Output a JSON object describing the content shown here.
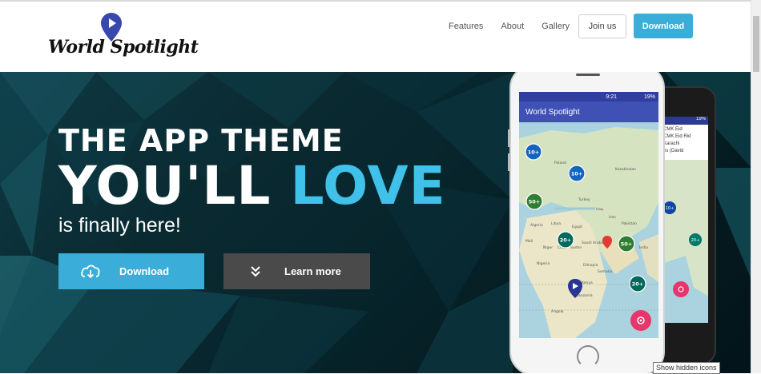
{
  "brand": {
    "name": "World Spotlight"
  },
  "nav": {
    "features": "Features",
    "about": "About",
    "gallery": "Gallery",
    "join": "Join us",
    "download": "Download"
  },
  "hero": {
    "line1": "THE APP THEME",
    "line2a": "YOU'LL",
    "line2b": "LOVE",
    "line3": "is finally here!",
    "download_label": "Download",
    "learn_more_label": "Learn more"
  },
  "phone": {
    "time": "9:21",
    "battery": "19%",
    "app_title": "World Spotlight",
    "clusters": [
      "10+",
      "10+",
      "50+",
      "20+",
      "50+",
      "20+"
    ],
    "map_labels": [
      "Libya",
      "Egypt",
      "Saudi Arabia",
      "Sudan",
      "Iran",
      "India",
      "Kenya",
      "Niger",
      "Nigeria",
      "Turkey",
      "Mali",
      "Chad",
      "Ethiopia",
      "Somalia",
      "Tanzania",
      "Angola",
      "Poland",
      "Ukraine",
      "Kazakhstan",
      "Algeria",
      "Iraq",
      "Pakistan"
    ]
  },
  "phone_back": {
    "battery": "19%",
    "list_lines": [
      "CMK Eid",
      "CMK Eid Rid",
      "Karachi",
      "es (David"
    ],
    "clusters": [
      "10+",
      "20+"
    ]
  },
  "taskbar_tooltip": "Show hidden icons",
  "colors": {
    "accent": "#3aaed8",
    "love": "#3fc1ea",
    "dark_button": "#4a4a4a",
    "app_bar": "#3f51b5",
    "fab": "#e8356b"
  }
}
